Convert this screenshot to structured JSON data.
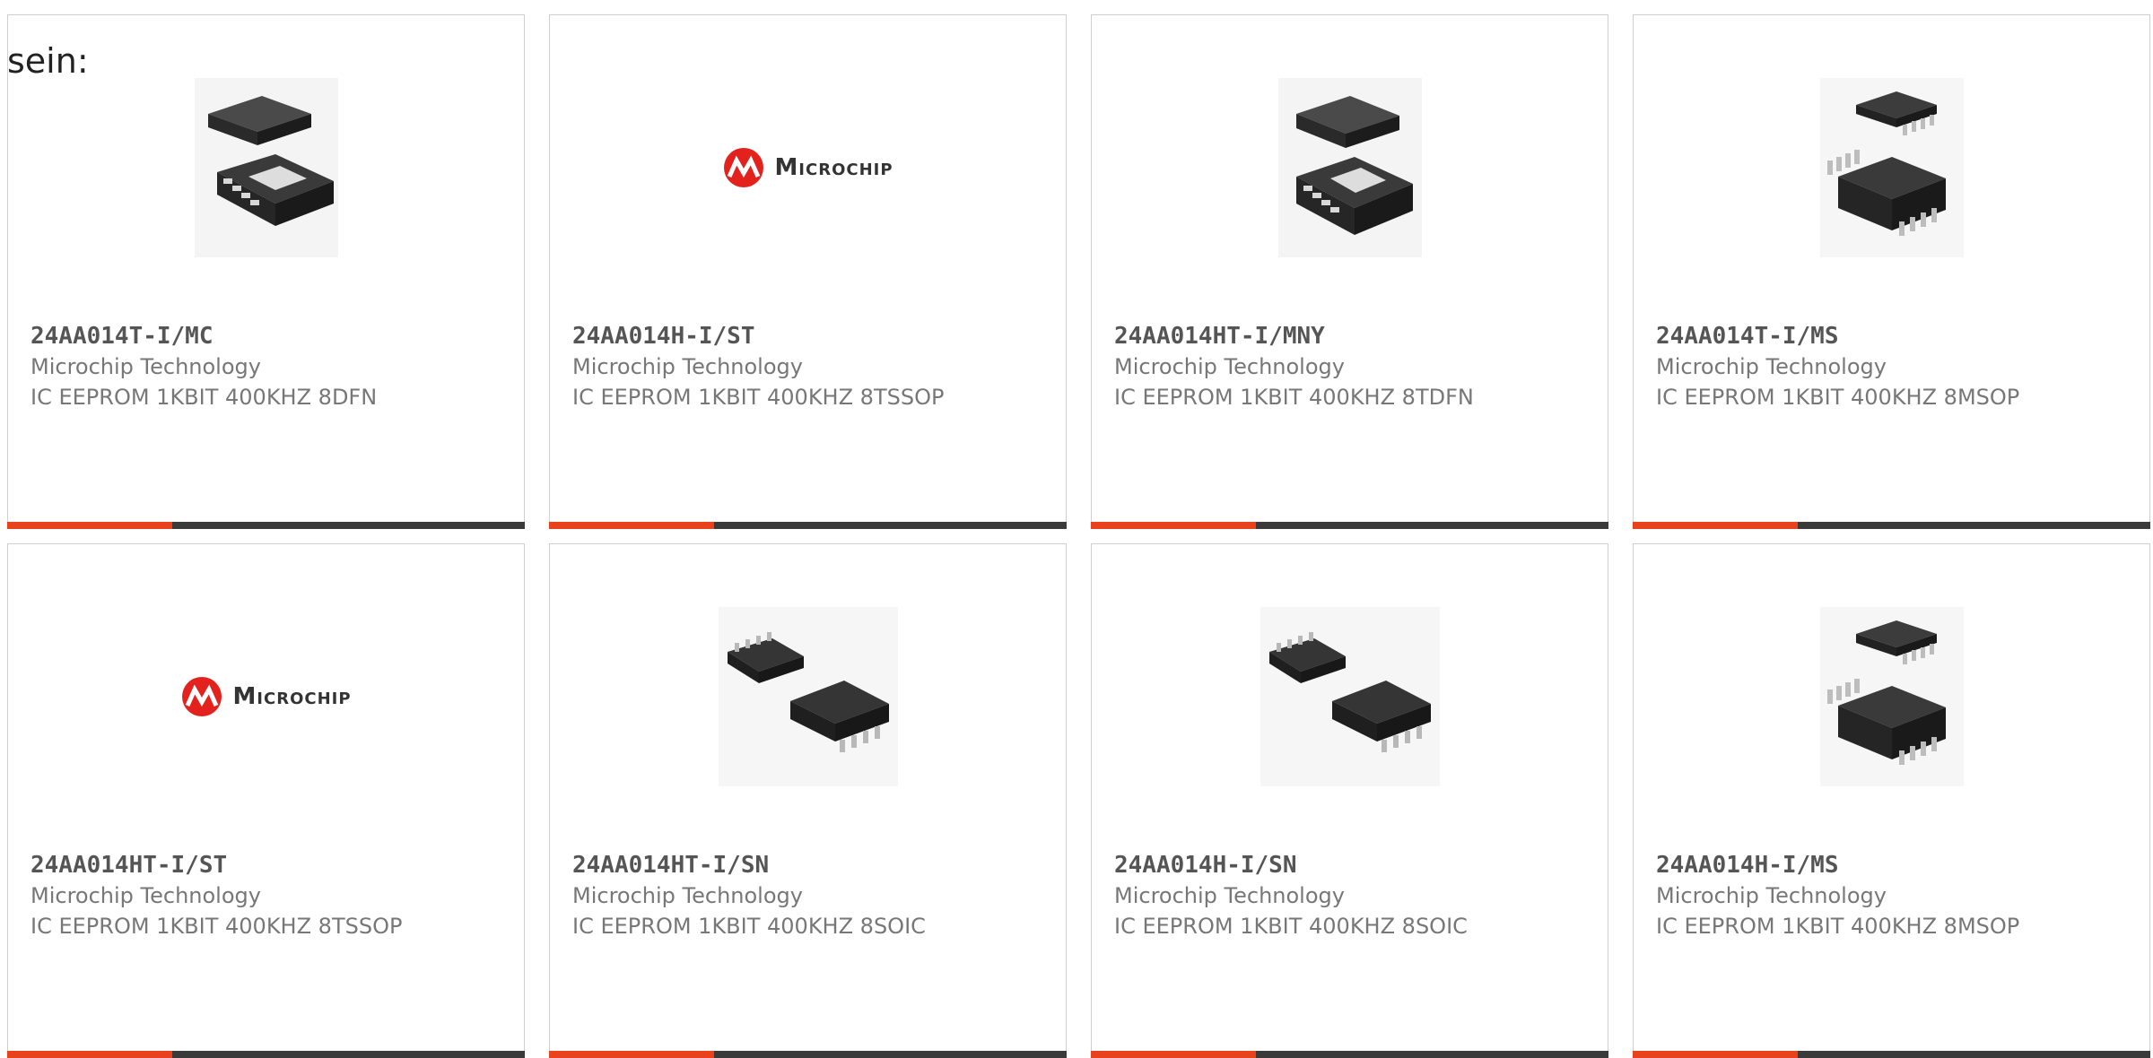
{
  "page": {
    "intro_text": "sein:",
    "accent_color": "#e8431c",
    "bar_color": "#3a3a3a"
  },
  "products": [
    {
      "part": "24AA014T-I/MC",
      "mfr": "Microchip Technology",
      "desc": "IC EEPROM 1KBIT 400KHZ 8DFN",
      "image": "dfn-package-icon"
    },
    {
      "part": "24AA014H-I/ST",
      "mfr": "Microchip Technology",
      "desc": "IC EEPROM 1KBIT 400KHZ 8TSSOP",
      "image": "microchip-logo",
      "logo_text": "Microchip"
    },
    {
      "part": "24AA014HT-I/MNY",
      "mfr": "Microchip Technology",
      "desc": "IC EEPROM 1KBIT 400KHZ 8TDFN",
      "image": "tdfn-package-icon"
    },
    {
      "part": "24AA014T-I/MS",
      "mfr": "Microchip Technology",
      "desc": "IC EEPROM 1KBIT 400KHZ 8MSOP",
      "image": "msop-package-icon"
    },
    {
      "part": "24AA014HT-I/ST",
      "mfr": "Microchip Technology",
      "desc": "IC EEPROM 1KBIT 400KHZ 8TSSOP",
      "image": "microchip-logo",
      "logo_text": "Microchip"
    },
    {
      "part": "24AA014HT-I/SN",
      "mfr": "Microchip Technology",
      "desc": "IC EEPROM 1KBIT 400KHZ 8SOIC",
      "image": "soic-package-icon"
    },
    {
      "part": "24AA014H-I/SN",
      "mfr": "Microchip Technology",
      "desc": "IC EEPROM 1KBIT 400KHZ 8SOIC",
      "image": "soic-package-icon"
    },
    {
      "part": "24AA014H-I/MS",
      "mfr": "Microchip Technology",
      "desc": "IC EEPROM 1KBIT 400KHZ 8MSOP",
      "image": "msop-package-icon"
    }
  ]
}
